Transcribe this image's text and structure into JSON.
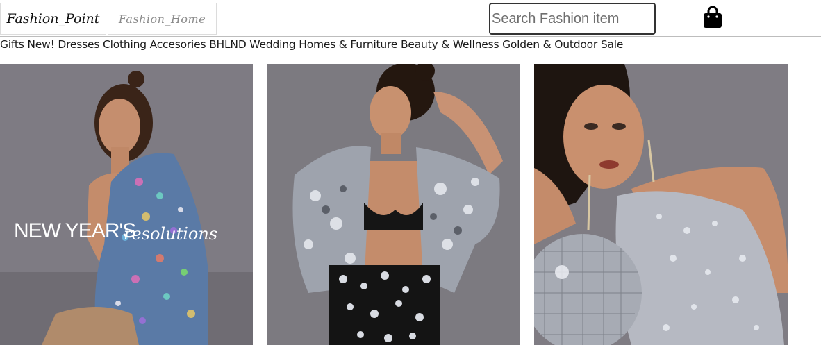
{
  "header": {
    "brand_primary": "Fashion_Point",
    "brand_secondary": "Fashion_Home",
    "search_placeholder": "Search Fashion item",
    "cart_icon": "shopping-bag-icon"
  },
  "nav": {
    "items": [
      "Gifts",
      "New!",
      "Dresses",
      "Clothing",
      "Accesories",
      "BHLND",
      "Wedding",
      "Homes & Furniture",
      "Beauty & Wellness",
      "Golden & Outdoor",
      "Sale"
    ]
  },
  "gallery": {
    "hero_text_main": "NEW YEAR'S",
    "hero_text_script": "resolutions"
  },
  "colors": {
    "backdrop": "#7d7a80",
    "sequin_multicolor": "#5c7fa8",
    "sequin_silver": "#b9bcc4",
    "skin": "#c48e70",
    "hair": "#2a1d17"
  }
}
